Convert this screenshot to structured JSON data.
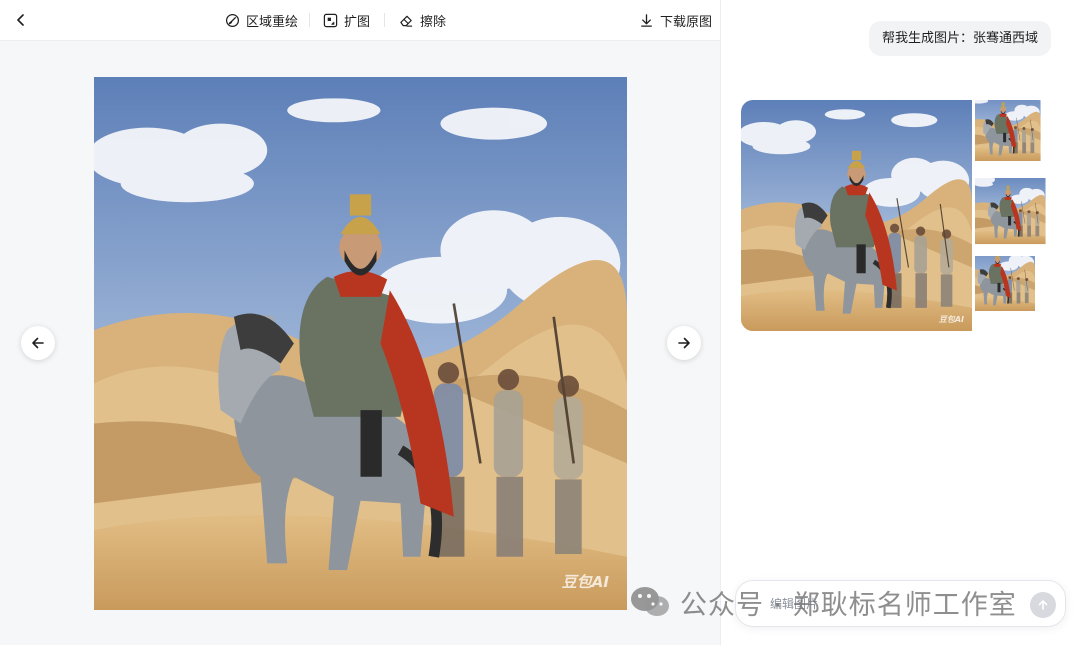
{
  "toolbar": {
    "back_icon": "chevron-left-icon",
    "tools": [
      {
        "label": "区域重绘",
        "icon": "brush-icon"
      },
      {
        "label": "扩图",
        "icon": "expand-icon"
      },
      {
        "label": "擦除",
        "icon": "eraser-icon"
      }
    ],
    "download": {
      "label": "下载原图",
      "icon": "download-icon"
    }
  },
  "viewer": {
    "image_watermark": "豆包AI",
    "prev_icon": "arrow-left-icon",
    "next_icon": "arrow-right-icon"
  },
  "chat": {
    "user_message": "帮我生成图片：张骞通西域",
    "thumbnail_watermark": "豆包AI",
    "input": {
      "placeholder": "编辑图片",
      "value": ""
    },
    "send_icon": "send-icon"
  },
  "watermark": {
    "text": "公众号 · 郑耿标名师工作室",
    "icon": "wechat-icon"
  },
  "colors": {
    "sky": "#6f8fc4",
    "sand": "#d9b37a",
    "cape": "#b8361f",
    "armor_gold": "#b8902f"
  }
}
